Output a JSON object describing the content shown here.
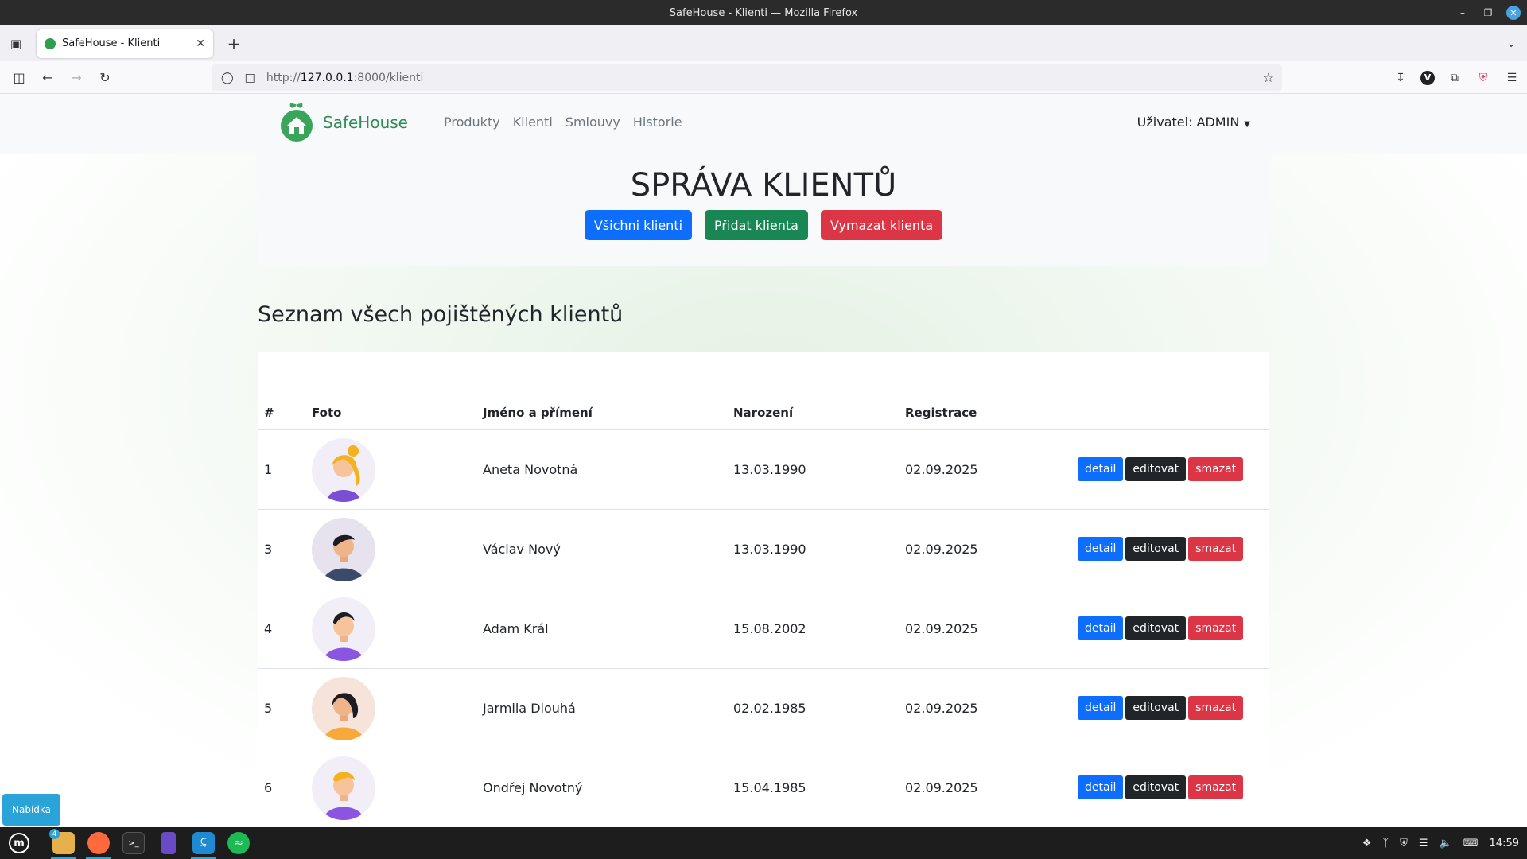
{
  "window": {
    "title": "SafeHouse - Klienti — Mozilla Firefox",
    "tab_title": "SafeHouse - Klienti",
    "url_prefix": "http://",
    "url_host": "127.0.0.1",
    "url_rest": ":8000/klienti"
  },
  "site": {
    "brand": "SafeHouse",
    "menu": [
      "Produkty",
      "Klienti",
      "Smlouvy",
      "Historie"
    ],
    "user_label": "Uživatel: ADMIN"
  },
  "hero": {
    "title": "SPRÁVA KLIENTŮ",
    "buttons": {
      "all": "Všichni klienti",
      "add": "Přidat klienta",
      "delete": "Vymazat klienta"
    }
  },
  "section_title": "Seznam všech pojištěných klientů",
  "table": {
    "headers": [
      "#",
      "Foto",
      "Jméno a přímení",
      "Narození",
      "Registrace"
    ],
    "actions": {
      "detail": "detail",
      "edit": "editovat",
      "delete": "smazat"
    },
    "rows": [
      {
        "id": "1",
        "name": "Aneta Novotná",
        "birth": "13.03.1990",
        "registered": "02.09.2025",
        "avatar": "woman-blonde-avatar"
      },
      {
        "id": "3",
        "name": "Václav Nový",
        "birth": "13.03.1990",
        "registered": "02.09.2025",
        "avatar": "man-dark-hair-avatar"
      },
      {
        "id": "4",
        "name": "Adam Král",
        "birth": "15.08.2002",
        "registered": "02.09.2025",
        "avatar": "man-purple-shirt-avatar"
      },
      {
        "id": "5",
        "name": "Jarmila Dlouhá",
        "birth": "02.02.1985",
        "registered": "02.09.2025",
        "avatar": "woman-dark-hair-avatar"
      },
      {
        "id": "6",
        "name": "Ondřej Novotný",
        "birth": "15.04.1985",
        "registered": "02.09.2025",
        "avatar": "man-yellow-cap-avatar"
      }
    ]
  },
  "overlay_button": "Nabídka",
  "taskbar": {
    "files_badge": "4",
    "clock": "14:59"
  },
  "colors": {
    "brand_green": "#2e8b57",
    "primary": "#0d6efd",
    "success": "#198754",
    "danger": "#dc3545",
    "dark": "#212529"
  }
}
